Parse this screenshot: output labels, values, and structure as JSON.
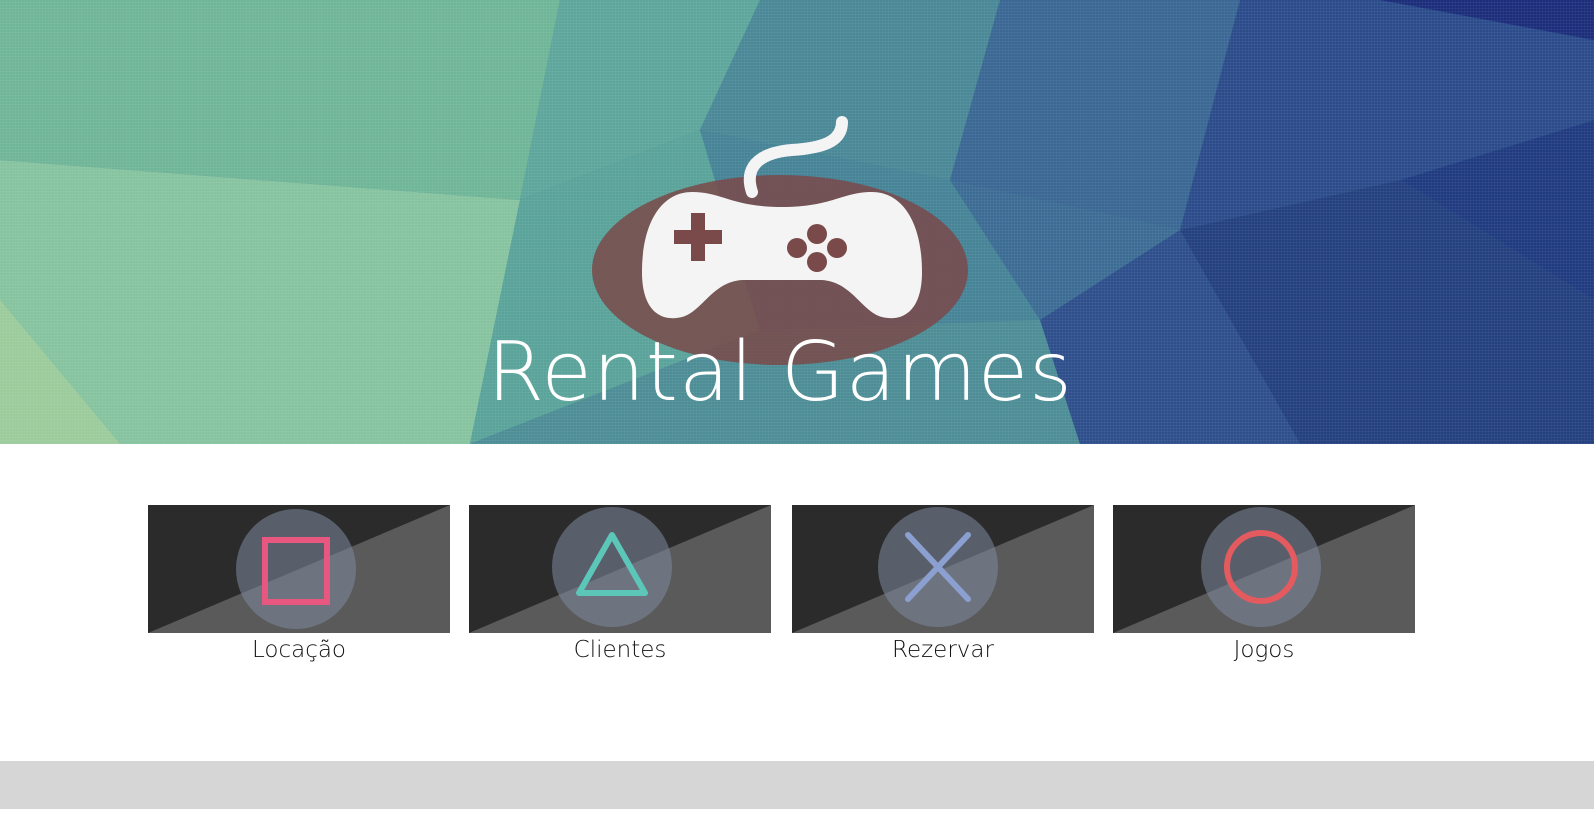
{
  "app": {
    "title": "Rental Games"
  },
  "colors": {
    "square": "#e8577f",
    "triangle": "#5cc7b8",
    "cross": "#8ba0d0",
    "circle": "#e35a5f",
    "logo_oval": "#7a4a4a",
    "controller": "#f4f4f4"
  },
  "menu": [
    {
      "label": "Locação",
      "icon": "square-icon"
    },
    {
      "label": "Clientes",
      "icon": "triangle-icon"
    },
    {
      "label": "Rezervar",
      "icon": "cross-icon"
    },
    {
      "label": "Jogos",
      "icon": "circle-icon"
    }
  ]
}
